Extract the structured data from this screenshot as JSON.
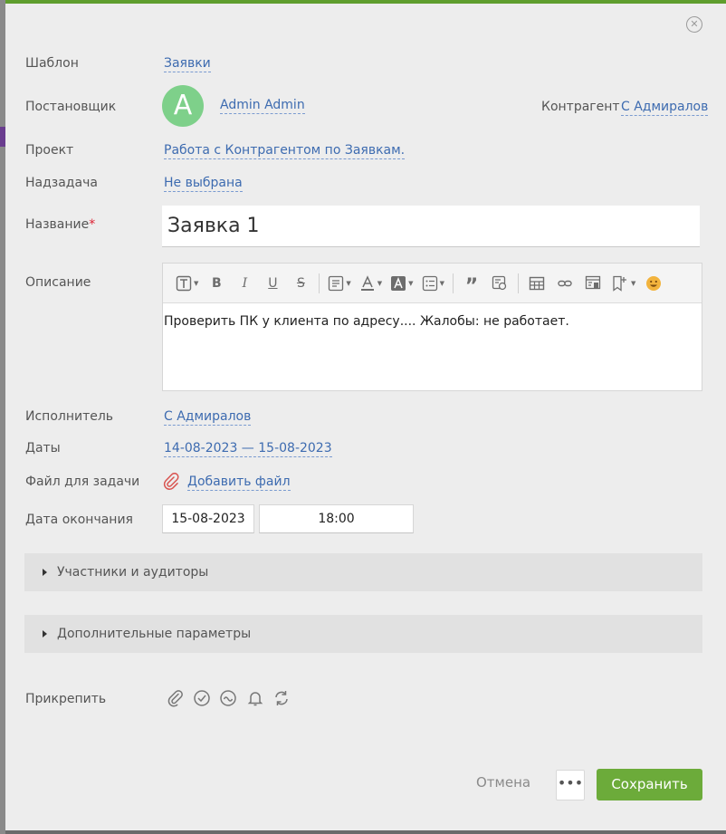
{
  "form": {
    "template_label": "Шаблон",
    "template_value": "Заявки",
    "assigner_label": "Постановщик",
    "assigner_avatar_letter": "A",
    "assigner_name": "Admin Admin",
    "contractor_label": "Контрагент",
    "contractor_value": "С Адмиралов",
    "project_label": "Проект",
    "project_value": "Работа с Контрагентом по Заявкам.",
    "parent_label": "Надзадача",
    "parent_value": "Не выбрана",
    "title_label": "Название",
    "title_required": "*",
    "title_value": "Заявка 1",
    "description_label": "Описание",
    "description_text": "Проверить ПК у клиента по адресу.... Жалобы: не работает.",
    "executor_label": "Исполнитель",
    "executor_value": "С Адмиралов",
    "dates_label": "Даты",
    "dates_value": "14-08-2023 — 15-08-2023",
    "file_label": "Файл для задачи",
    "file_link": "Добавить файл",
    "end_date_label": "Дата окончания",
    "end_date_value": "15-08-2023",
    "end_time_value": "18:00",
    "participants_section": "Участники и аудиторы",
    "extra_section": "Дополнительные параметры",
    "attach_label": "Прикрепить"
  },
  "footer": {
    "cancel_label": "Отмена",
    "more_label": "•••",
    "save_label": "Сохранить"
  },
  "colors": {
    "accent": "#6cab3a",
    "link": "#3d6bb0",
    "avatar": "#7ed08a"
  }
}
